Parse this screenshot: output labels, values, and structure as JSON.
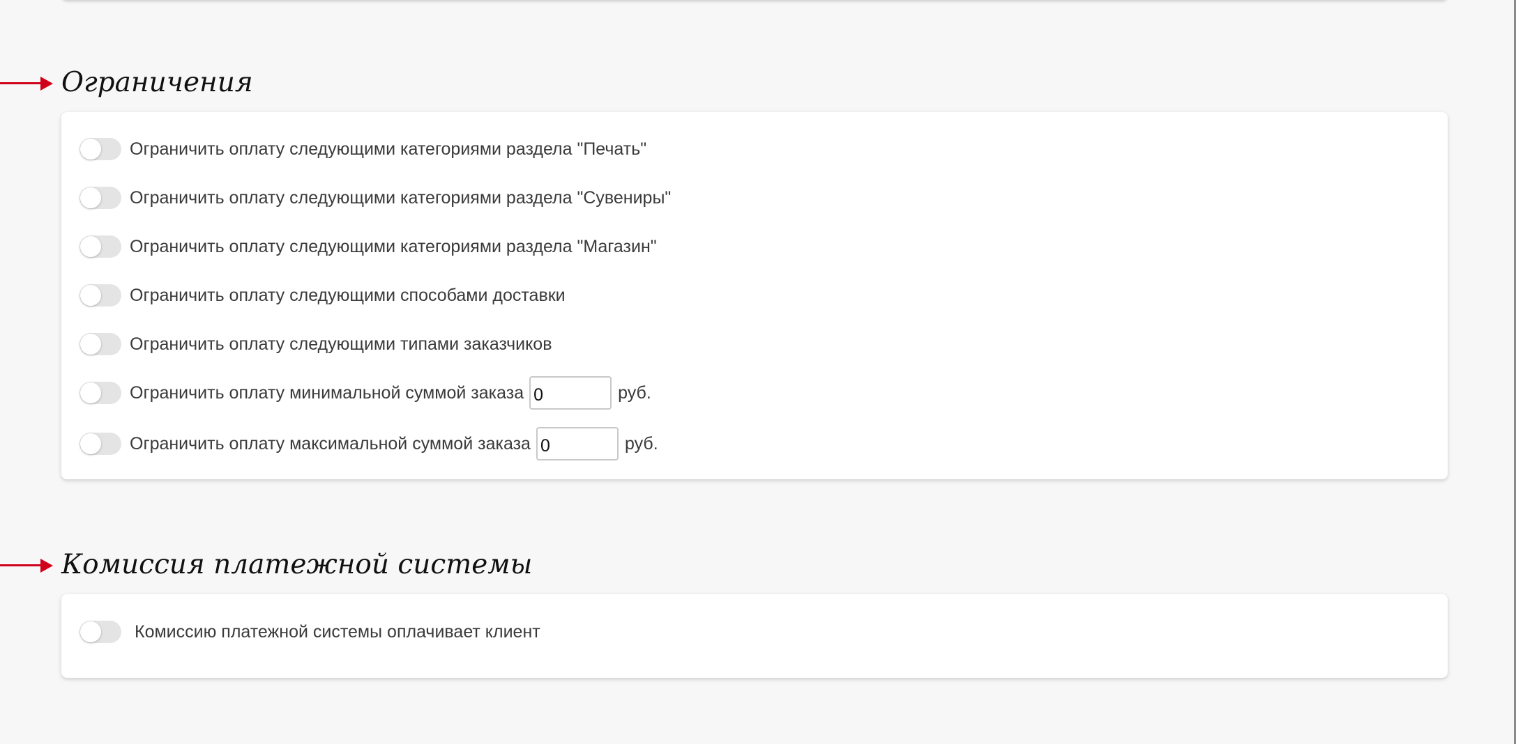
{
  "restrictions": {
    "title": "Ограничения",
    "options": [
      {
        "label": "Ограничить оплату следующими категориями раздела \"Печать\"",
        "enabled": false
      },
      {
        "label": "Ограничить оплату следующими категориями раздела \"Сувениры\"",
        "enabled": false
      },
      {
        "label": "Ограничить оплату следующими категориями раздела \"Магазин\"",
        "enabled": false
      },
      {
        "label": "Ограничить оплату следующими способами доставки",
        "enabled": false
      },
      {
        "label": "Ограничить оплату следующими типами заказчиков",
        "enabled": false
      }
    ],
    "min_amount": {
      "label": "Ограничить оплату минимальной суммой заказа",
      "value": "0",
      "unit": "руб.",
      "enabled": false
    },
    "max_amount": {
      "label": "Ограничить оплату максимальной суммой заказа",
      "value": "0",
      "unit": "руб.",
      "enabled": false
    }
  },
  "commission": {
    "title": "Комиссия платежной системы",
    "option": {
      "label": "Комиссию платежной системы оплачивает клиент",
      "enabled": false
    }
  },
  "colors": {
    "page_background": "#f7f7f7",
    "card_background": "#ffffff",
    "arrow_accent": "#d0021b",
    "toggle_off": "#e4e4e4"
  }
}
